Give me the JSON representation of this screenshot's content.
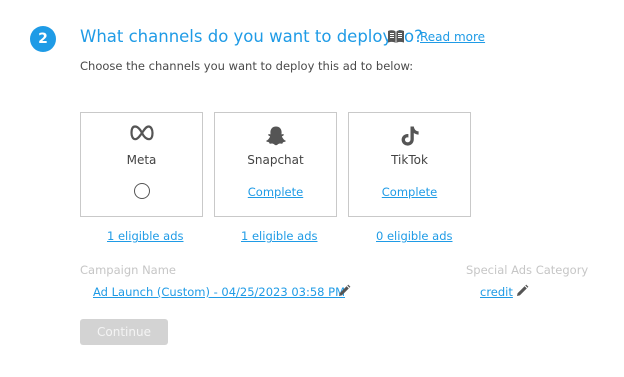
{
  "step": {
    "number": "2"
  },
  "header": {
    "title": "What channels do you want to deploy to?",
    "read_more": "Read more",
    "subtitle": "Choose the channels you want to deploy this ad to below:"
  },
  "channels": [
    {
      "name": "Meta",
      "icon": "meta-icon",
      "status": "radio-unselected",
      "eligible": "1 eligible ads"
    },
    {
      "name": "Snapchat",
      "icon": "snapchat-icon",
      "status": "Complete",
      "eligible": "1 eligible ads"
    },
    {
      "name": "TikTok",
      "icon": "tiktok-icon",
      "status": "Complete",
      "eligible": "0 eligible ads"
    }
  ],
  "campaign": {
    "label": "Campaign Name",
    "value": "Ad Launch (Custom) - 04/25/2023 03:58 PM"
  },
  "special_ads": {
    "label": "Special Ads Category",
    "value": "credit"
  },
  "actions": {
    "continue": "Continue"
  },
  "colors": {
    "accent": "#1f9be6",
    "muted": "#c6c6c6",
    "disabled_button": "#d3d3d3"
  }
}
